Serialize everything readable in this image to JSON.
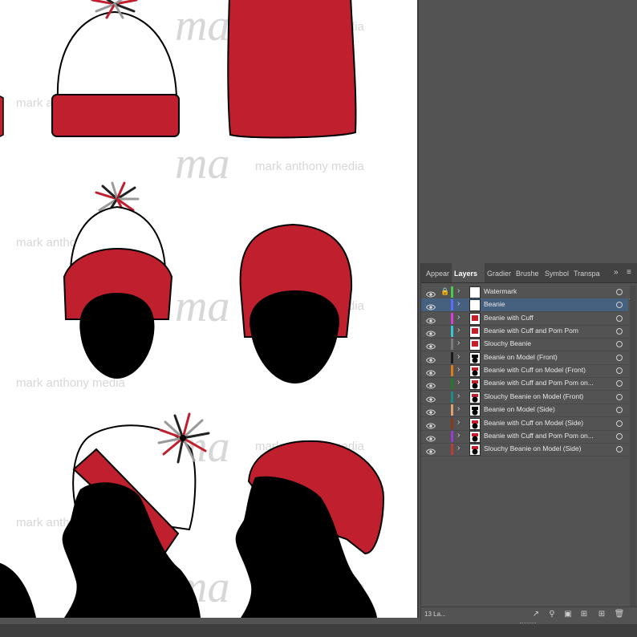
{
  "watermark": {
    "monogram": "ma",
    "text": "mark anthony media"
  },
  "panel": {
    "tabs": [
      {
        "label": "Appear",
        "active": false
      },
      {
        "label": "Layers",
        "active": true
      },
      {
        "label": "Gradier",
        "active": false
      },
      {
        "label": "Brushe",
        "active": false
      },
      {
        "label": "Symbol",
        "active": false
      },
      {
        "label": "Transpa",
        "active": false
      }
    ],
    "more_icon": "double-chevron-right-icon",
    "menu_icon": "hamburger-icon",
    "layers": [
      {
        "name": "Watermark",
        "color": "#4fc84f",
        "locked": true,
        "selected": false,
        "thumb": "blank"
      },
      {
        "name": "Beanie",
        "color": "#5b6cff",
        "locked": false,
        "selected": true,
        "thumb": "white-cap"
      },
      {
        "name": "Beanie with Cuff",
        "color": "#d63fd6",
        "locked": false,
        "selected": false,
        "thumb": "cuff"
      },
      {
        "name": "Beanie with Cuff and Pom Pom",
        "color": "#36c6d6",
        "locked": false,
        "selected": false,
        "thumb": "pom"
      },
      {
        "name": "Slouchy Beanie",
        "color": "#7a7a7a",
        "locked": false,
        "selected": false,
        "thumb": "slouch"
      },
      {
        "name": "Beanie on Model (Front)",
        "color": "#1a1a1a",
        "locked": false,
        "selected": false,
        "thumb": "head"
      },
      {
        "name": "Beanie with Cuff on Model (Front)",
        "color": "#e07a1a",
        "locked": false,
        "selected": false,
        "thumb": "head-red"
      },
      {
        "name": "Beanie with Cuff and Pom Pom on...",
        "color": "#1f7a2a",
        "locked": false,
        "selected": false,
        "thumb": "head-red"
      },
      {
        "name": "Slouchy Beanie on Model (Front)",
        "color": "#1b8a8a",
        "locked": false,
        "selected": false,
        "thumb": "head-red"
      },
      {
        "name": "Beanie on Model (Side)",
        "color": "#e0a070",
        "locked": false,
        "selected": false,
        "thumb": "side"
      },
      {
        "name": "Beanie with Cuff on Model (Side)",
        "color": "#8a3a1a",
        "locked": false,
        "selected": false,
        "thumb": "side-red"
      },
      {
        "name": "Beanie with Cuff and Pom Pom on...",
        "color": "#9a3ad6",
        "locked": false,
        "selected": false,
        "thumb": "side-red"
      },
      {
        "name": "Slouchy Beanie on Model (Side)",
        "color": "#c03a3a",
        "locked": false,
        "selected": false,
        "thumb": "side-red"
      }
    ],
    "footer": {
      "count": "13 La...",
      "icons": [
        "export-icon",
        "search-icon",
        "clipping-mask-icon",
        "new-sublayer-icon",
        "new-layer-icon",
        "trash-icon"
      ]
    }
  },
  "colors": {
    "beanie_red": "#c0202e",
    "panel_bg": "#535353",
    "selection": "#46607f"
  }
}
